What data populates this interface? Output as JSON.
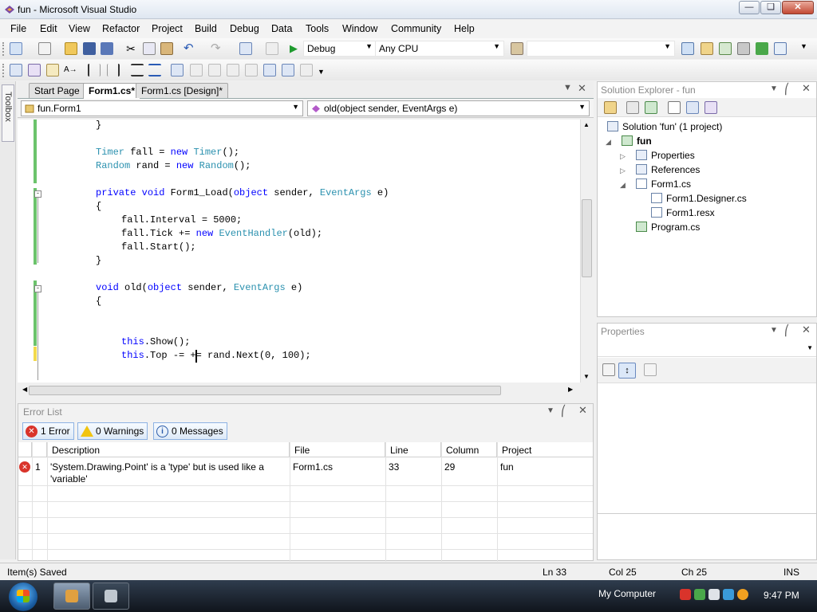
{
  "window": {
    "title": "fun - Microsoft Visual Studio",
    "minimize_icon": "minimize-icon",
    "maximize_icon": "restore-icon",
    "close_icon": "close-icon"
  },
  "menu": [
    "File",
    "Edit",
    "View",
    "Refactor",
    "Project",
    "Build",
    "Debug",
    "Data",
    "Tools",
    "Window",
    "Community",
    "Help"
  ],
  "toolbar": {
    "config": "Debug",
    "platform": "Any CPU"
  },
  "toolbox": {
    "label": "Toolbox"
  },
  "tabs": [
    "Start Page",
    "Form1.cs*",
    "Form1.cs [Design]*"
  ],
  "nav": {
    "class": "fun.Form1",
    "member": "old(object sender, EventArgs e)"
  },
  "code": {
    "l1": "}",
    "l3a": "Timer",
    "l3b": " fall = ",
    "l3c": "new",
    "l3d": "Timer",
    "l3e": "();",
    "l4a": "Random",
    "l4b": " rand = ",
    "l4c": "new",
    "l4d": "Random",
    "l4e": "();",
    "l6a": "private",
    "l6b": "void",
    "l6c": " Form1_Load(",
    "l6d": "object",
    "l6e": " sender, ",
    "l6f": "EventArgs",
    "l6g": " e)",
    "l7": "{",
    "l8": "fall.Interval = 5000;",
    "l9a": "fall.Tick += ",
    "l9b": "new",
    "l9c": "EventHandler",
    "l9d": "(old);",
    "l10": "fall.Start();",
    "l11": "}",
    "l13a": "void",
    "l13b": " old(",
    "l13c": "object",
    "l13d": " sender, ",
    "l13e": "EventArgs",
    "l13f": " e)",
    "l14": "{",
    "l17a": "this",
    "l17b": ".Show();",
    "l18a": "this",
    "l18b": ".Top -= += rand.Next(0, 100);"
  },
  "errors": {
    "title": "Error List",
    "error_btn": "1 Error",
    "warning_btn": "0 Warnings",
    "message_btn": "0 Messages",
    "columns": [
      "Description",
      "File",
      "Line",
      "Column",
      "Project"
    ],
    "rows": [
      {
        "num": "1",
        "desc1": "'System.Drawing.Point' is a 'type' but is used like a",
        "desc2": "'variable'",
        "file": "Form1.cs",
        "line": "33",
        "column": "29",
        "project": "fun"
      }
    ]
  },
  "solution": {
    "title": "Solution Explorer - fun",
    "root": "Solution 'fun' (1 project)",
    "project": "fun",
    "items": [
      "Properties",
      "References",
      "Form1.cs",
      "Form1.Designer.cs",
      "Form1.resx",
      "Program.cs"
    ]
  },
  "properties": {
    "title": "Properties"
  },
  "status": {
    "msg": "Item(s) Saved",
    "ln": "Ln 33",
    "col": "Col 25",
    "ch": "Ch 25",
    "mode": "INS"
  },
  "taskbar": {
    "computer": "My Computer",
    "time": "9:47 PM"
  },
  "colors": {
    "keyword": "#0000ff",
    "type": "#2b91af",
    "changed": "#6cc36c",
    "unsaved": "#f2d94c",
    "error": "#d9342b"
  }
}
